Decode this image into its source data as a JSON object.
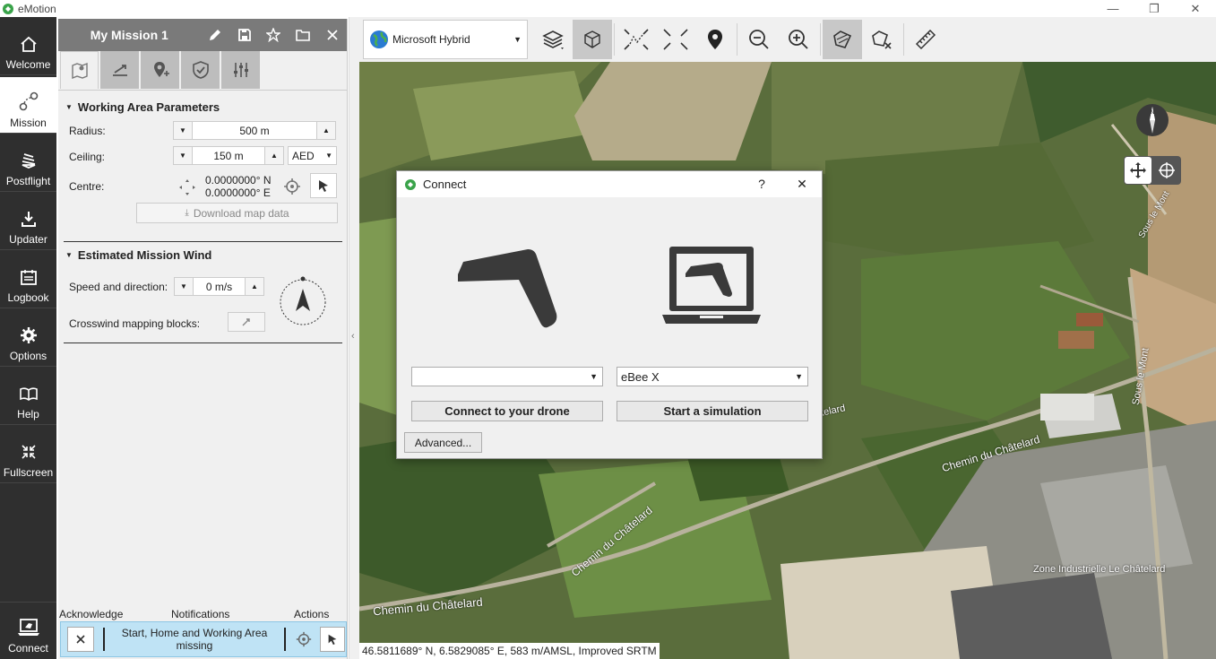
{
  "app": {
    "title": "eMotion"
  },
  "window_controls": {
    "minimize": "—",
    "restore": "❐",
    "close": "✕"
  },
  "nav": {
    "items": [
      {
        "label": "Welcome",
        "icon": "home-icon"
      },
      {
        "label": "Mission",
        "icon": "mission-icon"
      },
      {
        "label": "Postflight",
        "icon": "layers-icon"
      },
      {
        "label": "Updater",
        "icon": "download-icon"
      },
      {
        "label": "Logbook",
        "icon": "calendar-icon"
      },
      {
        "label": "Options",
        "icon": "gear-icon"
      },
      {
        "label": "Help",
        "icon": "book-icon"
      },
      {
        "label": "Fullscreen",
        "icon": "fullscreen-icon"
      }
    ],
    "connect_label": "Connect"
  },
  "mission": {
    "title": "My Mission 1",
    "working_area": {
      "header": "Working Area Parameters",
      "radius_label": "Radius:",
      "radius_value": "500 m",
      "ceiling_label": "Ceiling:",
      "ceiling_value": "150 m",
      "ceiling_ref": "AED",
      "centre_label": "Centre:",
      "centre_lat": "0.0000000° N",
      "centre_lon": "0.0000000° E",
      "download_label": "Download map data"
    },
    "wind": {
      "header": "Estimated Mission Wind",
      "speed_label": "Speed and direction:",
      "speed_value": "0 m/s",
      "crosswind_label": "Crosswind mapping blocks:"
    },
    "footer": {
      "acknowledge": "Acknowledge",
      "notifications": "Notifications",
      "actions": "Actions",
      "message": "Start, Home and Working Area missing"
    }
  },
  "map": {
    "map_type": "Microsoft Hybrid",
    "coordinates": "46.5811689° N, 6.5829085° E, 583 m/AMSL, Improved SRTM",
    "street_labels": [
      {
        "text": "Chemin du Châtelard"
      },
      {
        "text": "Chemin du Châtelard"
      },
      {
        "text": "Chemin du Châtelard"
      },
      {
        "text": "Zone Industrielle Le Châtelard"
      },
      {
        "text": "Sous le Mont"
      },
      {
        "text": "Sous le Mont"
      },
      {
        "text": "telard"
      }
    ]
  },
  "dialog": {
    "title": "Connect",
    "help": "?",
    "close": "✕",
    "drone_select": "",
    "sim_select": "eBee X",
    "connect_button": "Connect to your drone",
    "simulate_button": "Start a simulation",
    "advanced_button": "Advanced..."
  },
  "colors": {
    "nav_bg": "#2f2f2f",
    "panel_header": "#7a7a7a",
    "notification_bg": "#bfe3f5",
    "brand_green": "#3aa34a"
  }
}
